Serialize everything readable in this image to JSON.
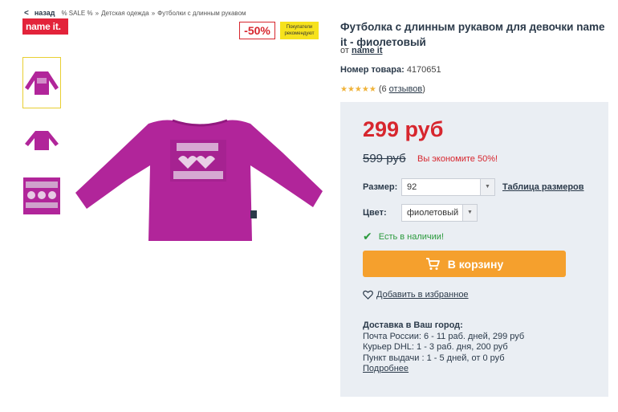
{
  "breadcrumb": {
    "back_label": "назад",
    "items": [
      "% SALE %",
      "Детская одежда",
      "Футболки с длинным рукавом"
    ],
    "separator": "»"
  },
  "brand_logo_text": "name it.",
  "badges": {
    "discount": "-50%",
    "recommended_line1": "Покупатели",
    "recommended_line2": "рекомендуют"
  },
  "product": {
    "title": "Футболка с длинным рукавом для девочки name it - фиолетовый",
    "by_label": "от",
    "brand": "name it",
    "sku_label": "Номер товара:",
    "sku": "4170651",
    "stars": "★★★★★",
    "reviews_open": "(6",
    "reviews_link": "отзывов",
    "reviews_close": ")"
  },
  "pricing": {
    "price": "299 руб",
    "old_price": "599 руб",
    "saving": "Вы экономите 50%!"
  },
  "options": {
    "size_label": "Размер:",
    "size_value": "92",
    "size_table_link": "Таблица размеров",
    "color_label": "Цвет:",
    "color_value": "фиолетовый"
  },
  "stock_text": "Есть в наличии!",
  "cart_button": "В корзину",
  "favorite_link": "Добавить в избранное",
  "delivery": {
    "heading": "Доставка в Ваш город:",
    "lines": [
      "Почта России: 6 - 11 раб. дней, 299 руб",
      "Курьер DHL: 1 - 3 раб. дня, 200 руб",
      "Пункт выдачи : 1 - 5 дней, от 0 руб"
    ],
    "more_link": "Подробнее"
  },
  "colors": {
    "accent_red": "#d7262e",
    "cart_orange": "#f5a02d",
    "shirt_magenta": "#b1259a",
    "panel_bg": "#eaeef3"
  }
}
